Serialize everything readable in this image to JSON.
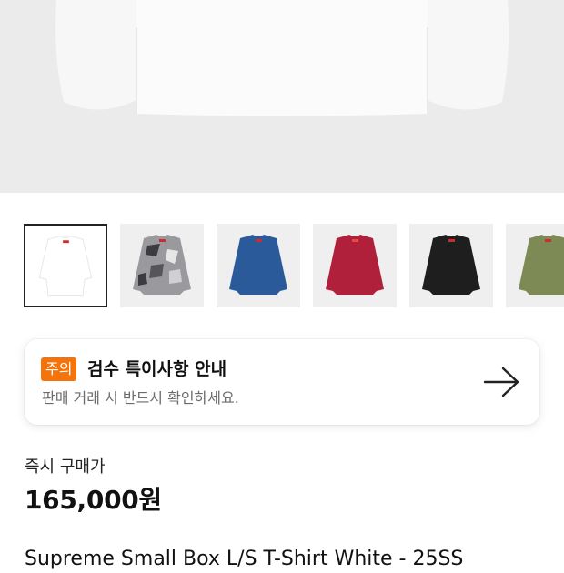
{
  "hero": {
    "image_alt": "Supreme Small Box L/S T-Shirt White product photo"
  },
  "thumbnails": [
    {
      "name": "white",
      "color": "#ffffff",
      "selected": true
    },
    {
      "name": "camo",
      "color": "#8e8e92",
      "selected": false
    },
    {
      "name": "blue",
      "color": "#2a5a9a",
      "selected": false
    },
    {
      "name": "red",
      "color": "#b0203a",
      "selected": false
    },
    {
      "name": "black",
      "color": "#1e1e1e",
      "selected": false
    },
    {
      "name": "olive",
      "color": "#7e8a55",
      "selected": false
    }
  ],
  "notice": {
    "badge": "주의",
    "title": "검수 특이사항 안내",
    "subtitle": "판매 거래 시 반드시 확인하세요.",
    "accent_color": "#f4730b"
  },
  "price": {
    "label": "즉시 구매가",
    "value": "165,000원"
  },
  "product": {
    "name": "Supreme Small Box L/S T-Shirt White - 25SS"
  }
}
